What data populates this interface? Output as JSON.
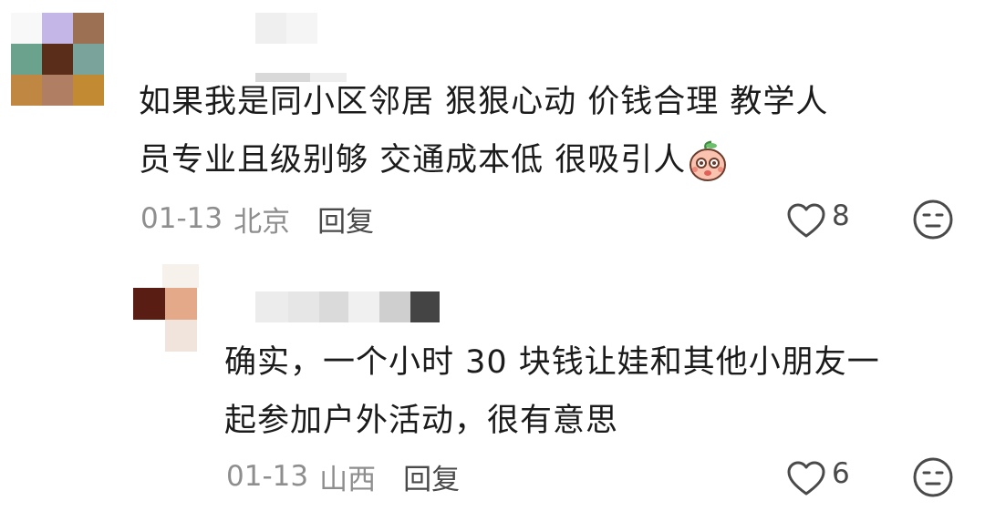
{
  "comments": [
    {
      "text_line1": "如果我是同小区邻居 狠狠心动 价钱合理 教学人",
      "text_line2": "员专业且级别够 交通成本低 很吸引人",
      "date": "01-13",
      "location": "北京",
      "reply_label": "回复",
      "like_count": "8",
      "emoji": "peach-face-emoji"
    },
    {
      "text_line1": "确实，一个小时 30 块钱让娃和其他小朋友一",
      "text_line2": "起参加户外活动，很有意思",
      "date": "01-13",
      "location": "山西",
      "reply_label": "回复",
      "like_count": "6"
    }
  ],
  "icons": {
    "like": "heart-outline-icon",
    "dislike": "neutral-face-icon"
  },
  "colors": {
    "text": "#1b1b1b",
    "meta": "#8e8e8e",
    "icon": "#4a4a4a",
    "emoji_face": "#f7b7a3"
  }
}
